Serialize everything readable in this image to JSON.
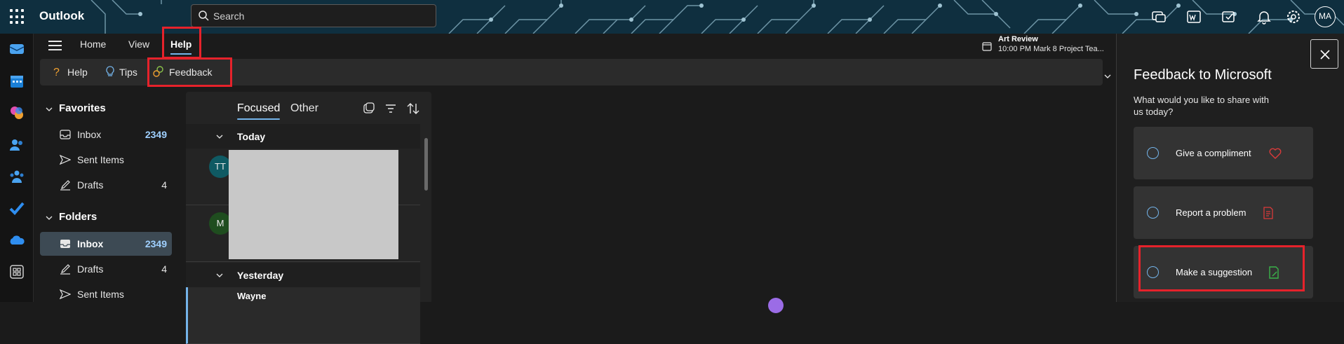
{
  "header": {
    "app_name": "Outlook",
    "search_placeholder": "Search",
    "avatar_initials": "MA"
  },
  "ribbon": {
    "tabs": [
      {
        "label": "Home"
      },
      {
        "label": "View"
      },
      {
        "label": "Help"
      }
    ],
    "active_tab": "Help",
    "help_buttons": [
      {
        "label": "Help"
      },
      {
        "label": "Tips"
      },
      {
        "label": "Feedback"
      }
    ]
  },
  "reminder": {
    "title": "Art Review",
    "subtitle": "10:00 PM Mark 8 Project Tea..."
  },
  "folders": {
    "favorites_label": "Favorites",
    "favorites": [
      {
        "label": "Inbox",
        "count": "2349"
      },
      {
        "label": "Sent Items",
        "count": ""
      },
      {
        "label": "Drafts",
        "count": "4"
      }
    ],
    "folders_label": "Folders",
    "folders": [
      {
        "label": "Inbox",
        "count": "2349"
      },
      {
        "label": "Drafts",
        "count": "4"
      },
      {
        "label": "Sent Items",
        "count": ""
      }
    ]
  },
  "mail_list": {
    "tabs": [
      {
        "label": "Focused"
      },
      {
        "label": "Other"
      }
    ],
    "groups": [
      {
        "label": "Today"
      },
      {
        "label": "Yesterday"
      }
    ],
    "messages": [
      {
        "initials": "TT",
        "avatar_color": "#0f5a63"
      },
      {
        "initials": "M",
        "avatar_color": "#1f4d1f"
      },
      {
        "sender": "Wayne"
      }
    ]
  },
  "feedback_panel": {
    "title": "Feedback to Microsoft",
    "question": "What would you like to share with us today?",
    "options": [
      {
        "label": "Give a compliment",
        "icon": "heart-icon"
      },
      {
        "label": "Report a problem",
        "icon": "report-icon"
      },
      {
        "label": "Make a suggestion",
        "icon": "suggestion-icon"
      }
    ]
  },
  "colors": {
    "accent": "#74b4ea",
    "highlight": "#e6222b",
    "selected_folder": "#3d4a54"
  }
}
